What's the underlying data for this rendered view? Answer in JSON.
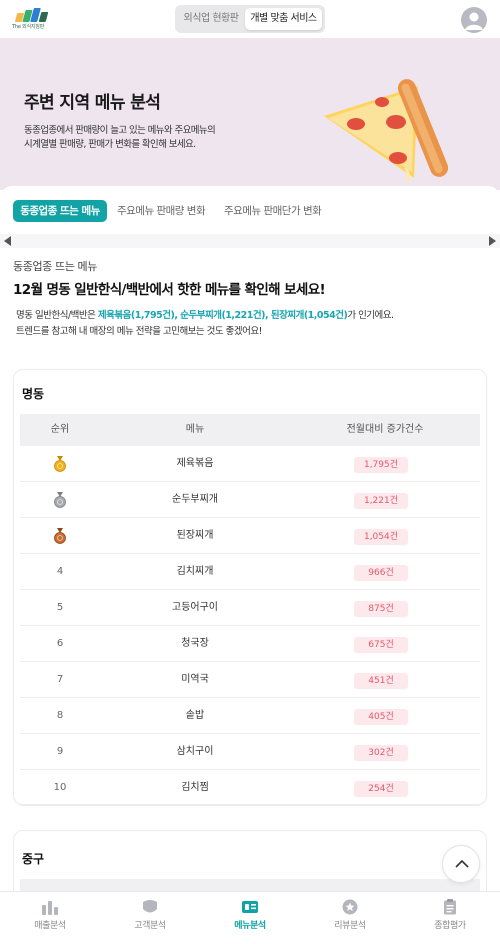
{
  "header": {
    "logo_text": "The 외식지침판",
    "segment_off": "외식업 현황판",
    "segment_on": "개별 맞춤 서비스"
  },
  "hero": {
    "title": "주변 지역 메뉴 분석",
    "desc_line1": "동종업종에서 판매량이 늘고 있는 메뉴와 주요메뉴의",
    "desc_line2": "시계열별 판매량, 판매가 변화를 확인해 보세요."
  },
  "tabs": [
    {
      "label": "동종업종 뜨는 메뉴",
      "active": true
    },
    {
      "label": "주요메뉴 판매량 변화",
      "active": false
    },
    {
      "label": "주요메뉴 판매단가 변화",
      "active": false
    }
  ],
  "section": {
    "label": "동종업종 뜨는 메뉴",
    "headline": "12월 명동 일반한식/백반에서 핫한 메뉴를 확인해 보세요!",
    "desc_prefix": "명동 일반한식/백반은 ",
    "hl1": "제육볶음(1,795건)",
    "sep1": ", ",
    "hl2": "순두부찌개(1,221건)",
    "sep2": ", ",
    "hl3": "된장찌개(1,054건)",
    "desc_suffix": "가 인기에요.",
    "desc_line2": "트렌드를 참고해 내 매장의 메뉴 전략을 고민해보는 것도 좋겠어요!"
  },
  "card1": {
    "title": "명동",
    "columns": [
      "순위",
      "메뉴",
      "전월대비 증가건수"
    ],
    "rows": [
      {
        "rank": "1",
        "medal": "gold",
        "menu": "제육볶음",
        "count": "1,795건"
      },
      {
        "rank": "2",
        "medal": "silver",
        "menu": "순두부찌개",
        "count": "1,221건"
      },
      {
        "rank": "3",
        "medal": "bronze",
        "menu": "된장찌개",
        "count": "1,054건"
      },
      {
        "rank": "4",
        "medal": "",
        "menu": "김치찌개",
        "count": "966건"
      },
      {
        "rank": "5",
        "medal": "",
        "menu": "고등어구이",
        "count": "875건"
      },
      {
        "rank": "6",
        "medal": "",
        "menu": "청국장",
        "count": "675건"
      },
      {
        "rank": "7",
        "medal": "",
        "menu": "미역국",
        "count": "451건"
      },
      {
        "rank": "8",
        "medal": "",
        "menu": "솥밥",
        "count": "405건"
      },
      {
        "rank": "9",
        "medal": "",
        "menu": "삼치구이",
        "count": "302건"
      },
      {
        "rank": "10",
        "medal": "",
        "menu": "김치찜",
        "count": "254건"
      }
    ]
  },
  "card2": {
    "title": "중구"
  },
  "bottom_nav": [
    {
      "label": "매출분석",
      "icon": "bar-chart-icon",
      "active": false
    },
    {
      "label": "고객분석",
      "icon": "customer-icon",
      "active": false
    },
    {
      "label": "메뉴분석",
      "icon": "menu-card-icon",
      "active": true
    },
    {
      "label": "리뷰분석",
      "icon": "review-star-icon",
      "active": false
    },
    {
      "label": "종합평가",
      "icon": "clipboard-icon",
      "active": false
    }
  ],
  "colors": {
    "accent": "#12a3a6",
    "hero_bg": "#eee5ee",
    "badge_text": "#e05a6b",
    "badge_bg": "#fde8ec"
  }
}
